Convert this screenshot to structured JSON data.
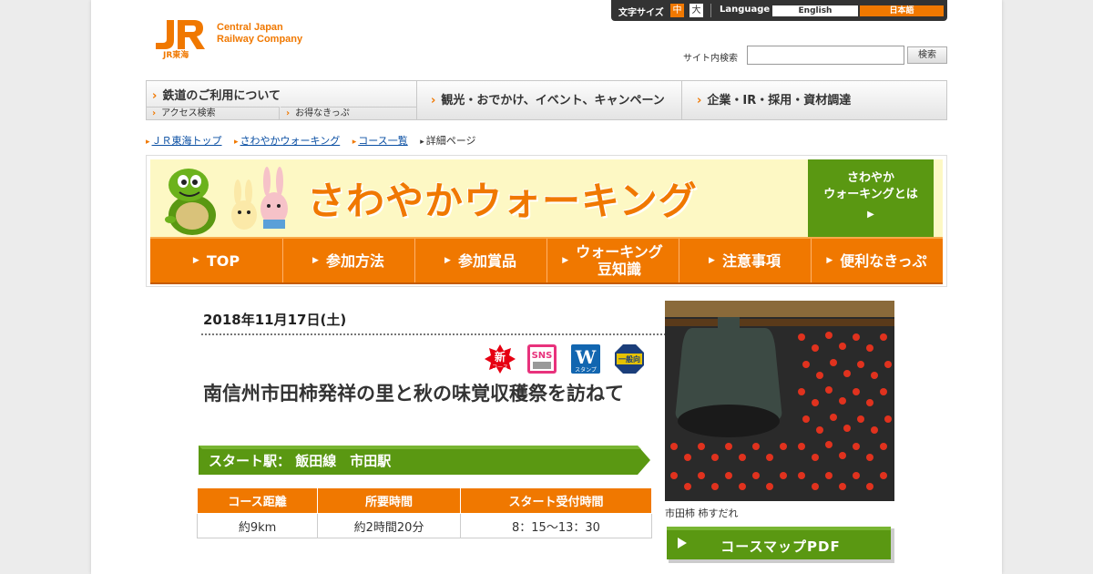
{
  "header": {
    "company_line1": "Central Japan",
    "company_line2": "Railway Company",
    "logo_sub": "JR東海",
    "font_size_label": "文字サイズ",
    "font_size_medium": "中",
    "font_size_large": "大",
    "language_label": "Language",
    "lang_english": "English",
    "lang_japanese": "日本語",
    "search_label": "サイト内検索",
    "search_value": "",
    "search_button": "検索"
  },
  "global_nav": {
    "rail": "鉄道のご利用について",
    "rail_sub1": "アクセス検索",
    "rail_sub2": "お得なきっぷ",
    "tour": "観光・おでかけ、イベント、キャンペーン",
    "corp": "企業・IR・採用・資材調達"
  },
  "breadcrumb": {
    "items": [
      "ＪＲ東海トップ",
      "さわやかウォーキング",
      "コース一覧",
      "詳細ページ"
    ]
  },
  "banner": {
    "title": "さわやかウォーキング",
    "whatis_line1": "さわやか",
    "whatis_line2": "ウォーキングとは",
    "nav": [
      {
        "label": "TOP"
      },
      {
        "label": "参加方法"
      },
      {
        "label": "参加賞品"
      },
      {
        "label": "ウォーキング",
        "label2": "豆知識"
      },
      {
        "label": "注意事項"
      },
      {
        "label": "便利なきっぷ"
      }
    ]
  },
  "course": {
    "date": "2018年11月17日(土)",
    "badges": {
      "new": "新",
      "new_sub": "コース",
      "sns": "SNS",
      "w": "W",
      "w_sub": "スタンプ",
      "general": "一般向"
    },
    "title": "南信州市田柿発祥の里と秋の味覚収穫祭を訪ねて",
    "start_station": "スタート駅： 飯田線　市田駅",
    "table": {
      "headers": [
        "コース距離",
        "所要時間",
        "スタート受付時間"
      ],
      "values": [
        "約9km",
        "約2時間20分",
        "8：15～13：30"
      ]
    }
  },
  "sidebar": {
    "photo_caption": "市田柿 柿すだれ",
    "pdf_button": "コースマップPDF"
  },
  "colors": {
    "accent_orange": "#f07800",
    "green": "#5a9812",
    "link": "#0a4fa3"
  }
}
